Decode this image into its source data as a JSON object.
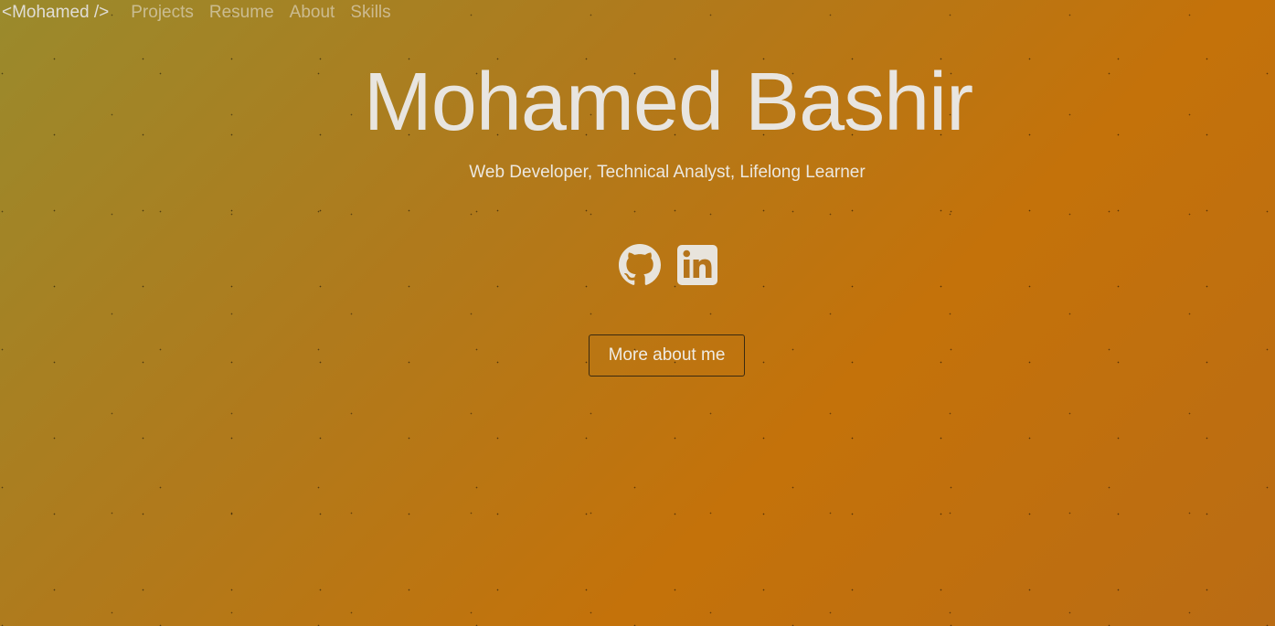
{
  "navbar": {
    "brand": "<Mohamed />",
    "links": [
      {
        "label": "Projects"
      },
      {
        "label": "Resume"
      },
      {
        "label": "About"
      },
      {
        "label": "Skills"
      }
    ]
  },
  "hero": {
    "title": "Mohamed Bashir",
    "subtitle": "Web Developer, Technical Analyst, Lifelong Learner",
    "social": [
      {
        "icon": "github-icon"
      },
      {
        "icon": "linkedin-icon"
      }
    ],
    "cta_label": "More about me"
  },
  "colors": {
    "background_start": "#9a8a2c",
    "background_end": "#c4720a",
    "text": "#e6e6e6",
    "button_border": "#3a2a10"
  }
}
